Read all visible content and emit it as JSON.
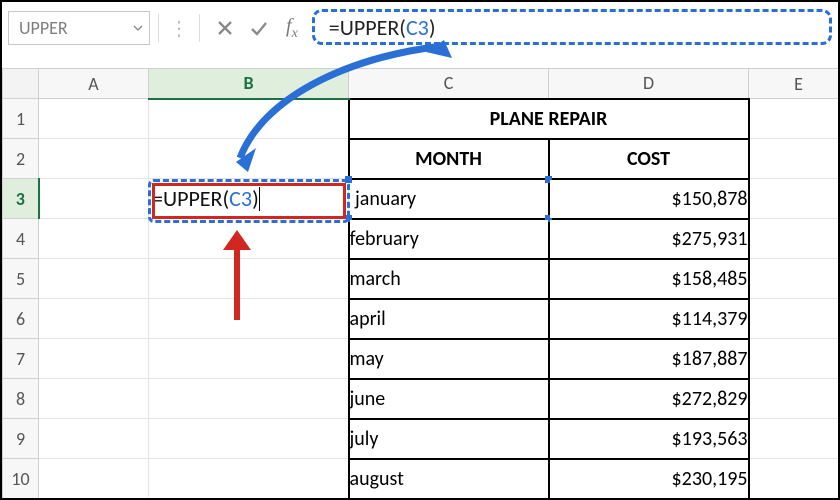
{
  "toolbar": {
    "name_box": "UPPER",
    "formula": {
      "prefix": "=UPPER(",
      "ref": "C3",
      "suffix": ")"
    }
  },
  "columns": {
    "A": "A",
    "B": "B",
    "C": "C",
    "D": "D",
    "E": "E"
  },
  "rows": [
    "1",
    "2",
    "3",
    "4",
    "5",
    "6",
    "7",
    "8",
    "9",
    "10"
  ],
  "active_cell": "B3",
  "referenced_cell": "C3",
  "b3_display": {
    "prefix": "=UPPER(",
    "ref": "C3",
    "suffix": ")"
  },
  "table": {
    "title": "PLANE REPAIR",
    "headers": {
      "month": "MONTH",
      "cost": "COST"
    },
    "rows": [
      {
        "month": "january",
        "cost": "$150,878"
      },
      {
        "month": "february",
        "cost": "$275,931"
      },
      {
        "month": "march",
        "cost": "$158,485"
      },
      {
        "month": "april",
        "cost": "$114,379"
      },
      {
        "month": "may",
        "cost": "$187,887"
      },
      {
        "month": "june",
        "cost": "$272,829"
      },
      {
        "month": "july",
        "cost": "$193,563"
      },
      {
        "month": "august",
        "cost": "$230,195"
      }
    ]
  },
  "chart_data": {
    "type": "table",
    "title": "PLANE REPAIR",
    "columns": [
      "MONTH",
      "COST"
    ],
    "rows": [
      [
        "january",
        150878
      ],
      [
        "february",
        275931
      ],
      [
        "march",
        158485
      ],
      [
        "april",
        114379
      ],
      [
        "may",
        187887
      ],
      [
        "june",
        272829
      ],
      [
        "july",
        193563
      ],
      [
        "august",
        230195
      ]
    ]
  },
  "icons": {
    "dropdown": "chevron-down-icon",
    "more": "more-icon",
    "cancel": "cancel-icon",
    "accept": "accept-icon",
    "fx": "fx-icon"
  },
  "colors": {
    "accent": "#2a6fd6",
    "excel_green": "#1e7145",
    "annotate_red": "#d0281e"
  }
}
